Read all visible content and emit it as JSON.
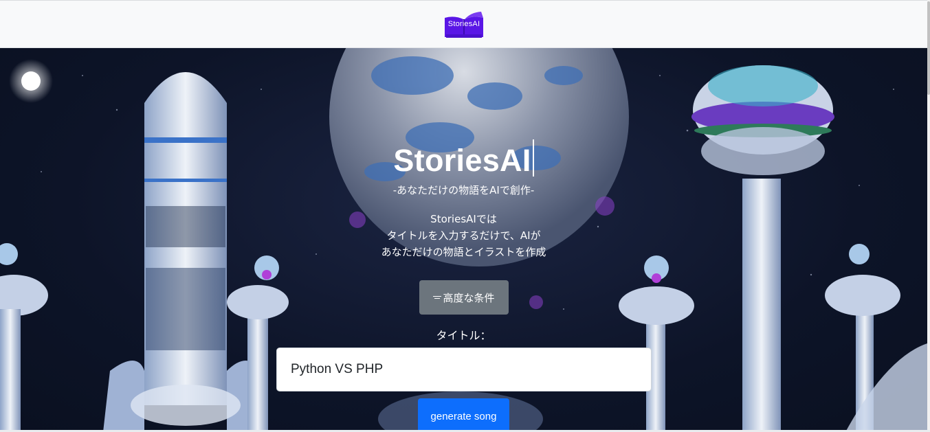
{
  "navbar": {
    "logo_text": "StoriesAI"
  },
  "hero": {
    "title": "StoriesAI",
    "subtitle": "-あなただけの物語をAIで創作-",
    "description_lines": [
      "StoriesAIでは",
      "タイトルを入力するだけで、AIが",
      "あなただけの物語とイラストを作成"
    ],
    "advanced_button_label": "高度な条件",
    "title_label": "タイトル：",
    "title_input_value": "Python VS PHP",
    "generate_button_label": "generate song"
  },
  "colors": {
    "navbar_bg": "#f8f9fa",
    "logo_purple": "#5a16e6",
    "advanced_button_bg": "#6c757d",
    "generate_button_bg": "#0d6efd",
    "hero_bg": "#0d1428"
  },
  "icons": {
    "logo": "book-logo-icon",
    "advanced_button": "filter-icon"
  }
}
